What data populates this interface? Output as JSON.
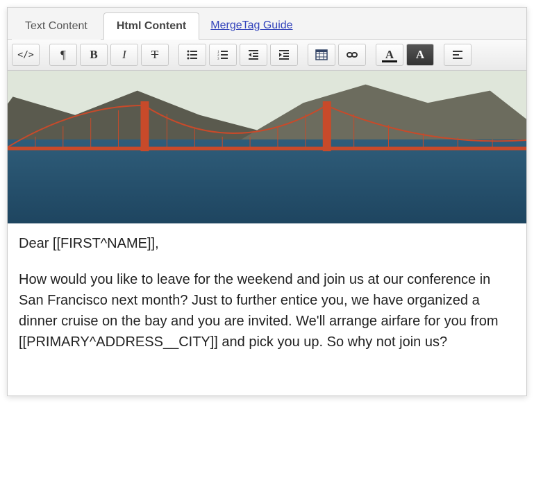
{
  "tabs": {
    "text": "Text Content",
    "html": "Html Content",
    "guide": "MergeTag Guide"
  },
  "toolbar": {
    "source": "</>",
    "pilcrow": "¶",
    "bold": "B",
    "italic": "I",
    "strike": "T",
    "textcolor": "A",
    "bgcolor": "A"
  },
  "email": {
    "greeting": "Dear [[FIRST^NAME]],",
    "paragraph": "How would you like to leave  for the weekend and join us at our conference in San Francisco next month? Just to further entice you, we have organized a dinner cruise on the bay and you are invited. We'll arrange airfare for you from [[PRIMARY^ADDRESS__CITY]] and pick you up. So why not join us?"
  }
}
